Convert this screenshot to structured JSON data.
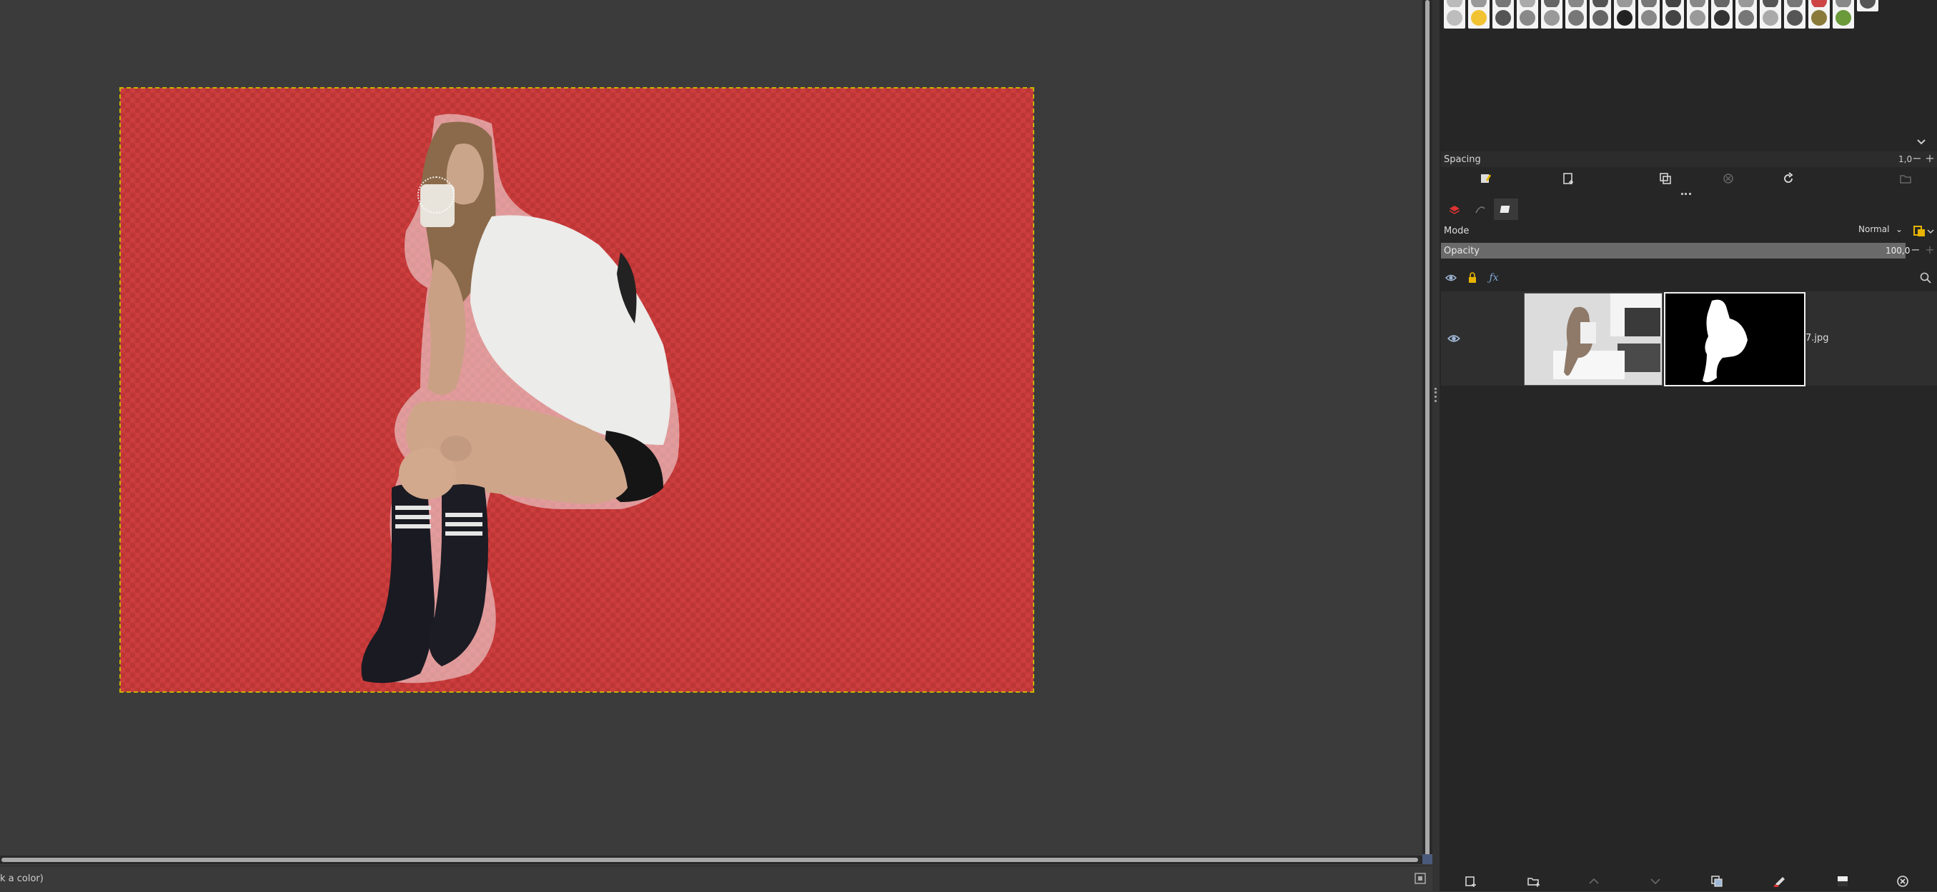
{
  "canvas": {
    "status_text": "k a color)"
  },
  "brushes": {
    "row2": [
      "#bdbdbd",
      "#f1c232",
      "#555",
      "#888",
      "#999",
      "#777",
      "#666",
      "#222",
      "#888",
      "#444",
      "#999",
      "#333",
      "#777",
      "#aaa",
      "#555",
      "#8a7a3a",
      "#6a9a3a"
    ]
  },
  "brush_options": {
    "spacing_label": "Spacing",
    "spacing_value": "1,0"
  },
  "layers": {
    "mode_label": "Mode",
    "mode_value": "Normal",
    "opacity_label": "Opacity",
    "opacity_value": "100,0",
    "items": [
      {
        "name": "7.jpg",
        "visible": true
      }
    ]
  },
  "colors": {
    "accent_icon": "#e8b400",
    "canvas_red": "#cc3d3d"
  }
}
